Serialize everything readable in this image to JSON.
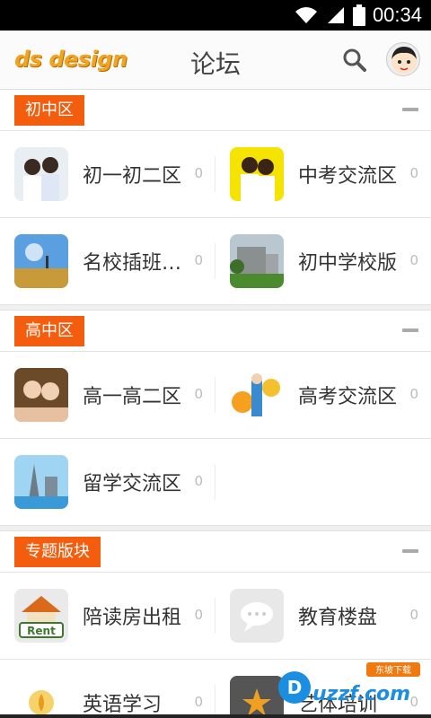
{
  "status": {
    "time": "00:34"
  },
  "header": {
    "logo": "ds design",
    "title": "论坛"
  },
  "sections": [
    {
      "tag": "初中区",
      "rows": [
        [
          {
            "label": "初一初二区",
            "count": "0"
          },
          {
            "label": "中考交流区",
            "count": "0"
          }
        ],
        [
          {
            "label": "名校插班…",
            "count": "0"
          },
          {
            "label": "初中学校版",
            "count": "0"
          }
        ]
      ]
    },
    {
      "tag": "高中区",
      "rows": [
        [
          {
            "label": "高一高二区",
            "count": "0"
          },
          {
            "label": "高考交流区",
            "count": "0"
          }
        ],
        [
          {
            "label": "留学交流区",
            "count": "0"
          }
        ]
      ]
    },
    {
      "tag": "专题版块",
      "rows": [
        [
          {
            "label": "陪读房出租",
            "count": "0"
          },
          {
            "label": "教育楼盘",
            "count": "0"
          }
        ],
        [
          {
            "label": "英语学习",
            "count": "0"
          },
          {
            "label": "艺体培训",
            "count": "0"
          }
        ]
      ]
    }
  ],
  "rent_label": "Rent",
  "watermark": {
    "text": "uzzf.com",
    "sub": "东坡下载"
  }
}
